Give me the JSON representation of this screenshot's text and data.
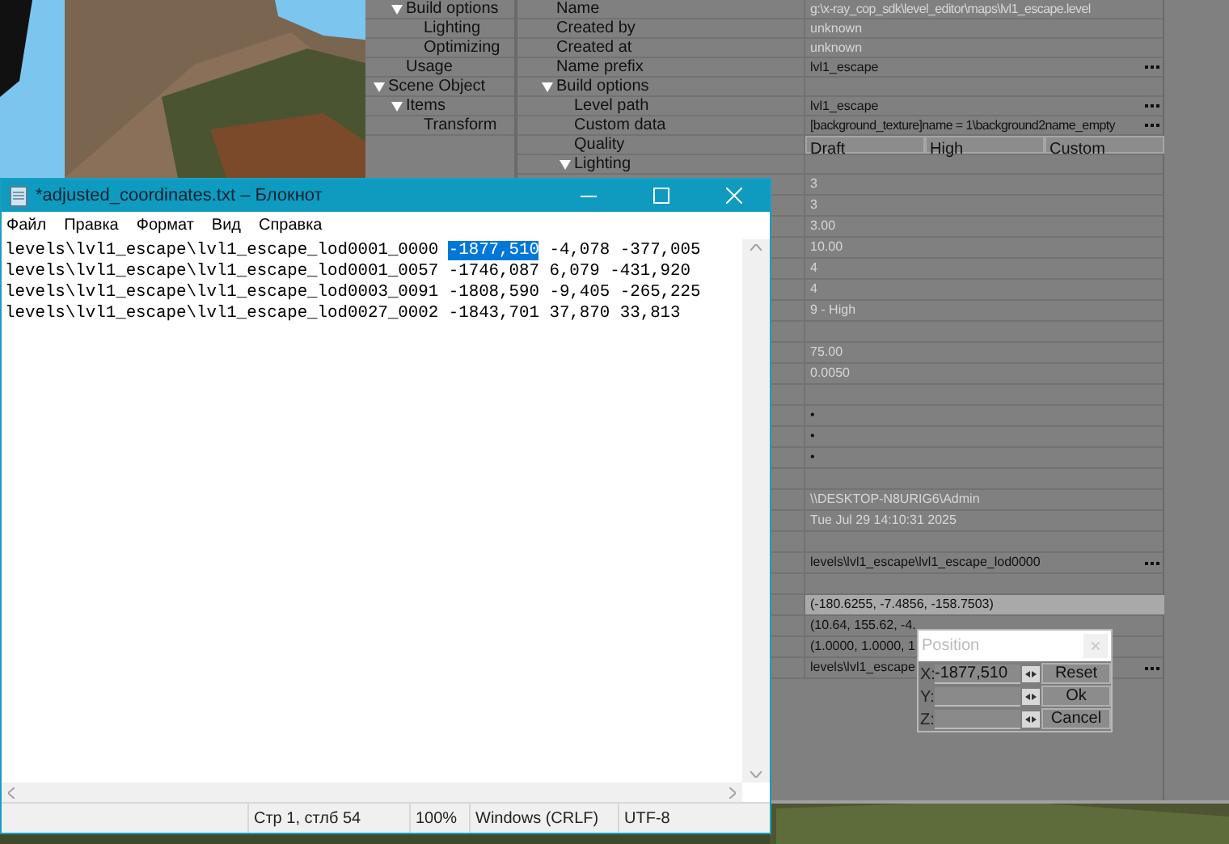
{
  "editor": {
    "tree_cut_branch": [
      {
        "label": "Build options",
        "expanded": true,
        "children": [
          {
            "label": "Lighting"
          },
          {
            "label": "Optimizing"
          }
        ]
      },
      {
        "label": "Usage"
      }
    ],
    "tree": [
      {
        "label": "Scene Object",
        "expanded": true,
        "children": [
          {
            "label": "Items",
            "expanded": true,
            "children": [
              {
                "label": "Transform"
              }
            ]
          }
        ]
      }
    ],
    "properties": [
      {
        "name": "Name",
        "value": "g:\\x-ray_cop_sdk\\level_editor\\maps\\lvl1_escape.level",
        "readonly": true
      },
      {
        "name": "Created by",
        "value": "unknown",
        "readonly": true
      },
      {
        "name": "Created at",
        "value": "unknown",
        "readonly": true
      },
      {
        "name": "Name prefix",
        "value": "lvl1_escape",
        "readonly": false,
        "button": true
      },
      {
        "name": "Build options",
        "expanded": true,
        "children": [
          {
            "name": "Level path",
            "value": "lvl1_escape",
            "readonly": false,
            "button": true
          },
          {
            "name": "Custom data",
            "value": "[background_texture]name = 1\\background2name_empty",
            "readonly": false,
            "button": true
          },
          {
            "name": "Quality",
            "options": [
              "Draft",
              "High",
              "Custom"
            ]
          },
          {
            "name": "Lighting",
            "expanded": true
          }
        ]
      }
    ],
    "value_rows": [
      {
        "value": "3",
        "readonly": true
      },
      {
        "value": "3",
        "readonly": true
      },
      {
        "value": "3.00",
        "readonly": true
      },
      {
        "value": "10.00",
        "readonly": true
      },
      {
        "value": "4",
        "readonly": true
      },
      {
        "value": "4",
        "readonly": true
      },
      {
        "value": "9 - High",
        "readonly": true
      },
      {},
      {
        "value": "75.00",
        "readonly": true
      },
      {
        "value": "0.0050",
        "readonly": true
      },
      {},
      {
        "value": "•",
        "readonly": false
      },
      {
        "value": "•",
        "readonly": false
      },
      {
        "value": "•",
        "readonly": false
      },
      {},
      {
        "value": "\\\\DESKTOP-N8URIG6\\Admin",
        "readonly": true
      },
      {
        "value": "Tue Jul 29 14:10:31 2025",
        "readonly": true
      },
      {},
      {
        "value": "levels\\lvl1_escape\\lvl1_escape_lod0000",
        "readonly": false,
        "button": true
      },
      {},
      {
        "value": "(-180.6255, -7.4856, -158.7503)",
        "readonly": false,
        "selected": true
      },
      {
        "value": "(10.64, 155.62, -4.",
        "readonly": false
      },
      {
        "value": "(1.0000, 1.0000, 1",
        "readonly": false
      },
      {
        "value": "levels\\lvl1_escape",
        "readonly": false,
        "button": true
      }
    ]
  },
  "position_dialog": {
    "title": "Position",
    "fields": [
      {
        "label": "X:",
        "value": "-1877,510"
      },
      {
        "label": "Y:"
      },
      {
        "label": "Z:"
      }
    ],
    "buttons": [
      "Reset",
      "Ok",
      "Cancel"
    ]
  },
  "notepad": {
    "title": "*adjusted_coordinates.txt – Блокнот",
    "menu": [
      "Файл",
      "Правка",
      "Формат",
      "Вид",
      "Справка"
    ],
    "lines": [
      [
        {
          "text": "levels\\lvl1_escape\\lvl1_escape_lod0001_0000 ",
          "selected": false
        },
        {
          "text": "-1877,510",
          "selected": true
        },
        {
          "text": " -4,078 -377,005",
          "selected": false
        }
      ],
      [
        {
          "text": "levels\\lvl1_escape\\lvl1_escape_lod0001_0057 -1746,087 6,079 -431,920",
          "selected": false
        }
      ],
      [
        {
          "text": "levels\\lvl1_escape\\lvl1_escape_lod0003_0091 -1808,590 -9,405 -265,225",
          "selected": false
        }
      ],
      [
        {
          "text": "levels\\lvl1_escape\\lvl1_escape_lod0027_0002 -1843,701 37,870 33,813",
          "selected": false
        }
      ]
    ],
    "status_bar": [
      "Стр 1, стлб 54",
      "100%",
      "Windows (CRLF)",
      "UTF-8"
    ]
  }
}
